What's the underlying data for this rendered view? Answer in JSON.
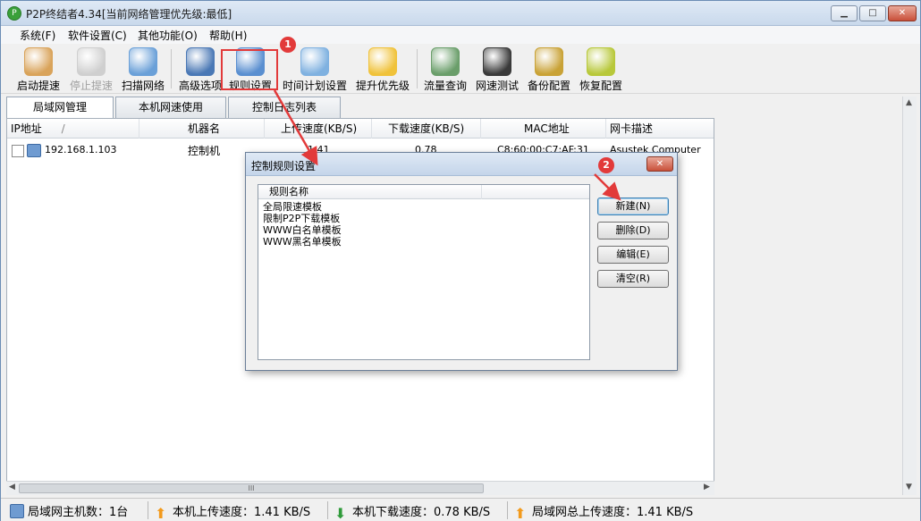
{
  "window": {
    "title": "P2P终结者4.34[当前网络管理优先级:最低]",
    "app_icon_glyph": "P",
    "min_glyph": "▁",
    "max_glyph": "□",
    "close_glyph": "✕"
  },
  "menu": [
    "系统(F)",
    "软件设置(C)",
    "其他功能(O)",
    "帮助(H)"
  ],
  "toolbar": [
    {
      "label": "启动提速",
      "icon": "rocket-icon",
      "color": "#d9a35a",
      "disabled": false
    },
    {
      "label": "停止提速",
      "icon": "stop-rocket-icon",
      "color": "#cfcfcf",
      "disabled": true
    },
    {
      "label": "扫描网络",
      "icon": "magnifier-icon",
      "color": "#6aa0d8",
      "disabled": false
    },
    {
      "label": "高级选项",
      "icon": "globe-gear-icon",
      "color": "#4a78b5",
      "disabled": false
    },
    {
      "label": "规则设置",
      "icon": "rules-icon",
      "color": "#5a8fd0",
      "disabled": false
    },
    {
      "label": "时间计划设置",
      "icon": "clock-icon",
      "color": "#7fb1e0",
      "disabled": false
    },
    {
      "label": "提升优先级",
      "icon": "medal-icon",
      "color": "#f0c23a",
      "disabled": false
    },
    {
      "label": "流量查询",
      "icon": "database-icon",
      "color": "#6a9e6a",
      "disabled": false
    },
    {
      "label": "网速测试",
      "icon": "speedometer-icon",
      "color": "#3a3a3a",
      "disabled": false
    },
    {
      "label": "备份配置",
      "icon": "backup-box-icon",
      "color": "#c9a236",
      "disabled": false
    },
    {
      "label": "恢复配置",
      "icon": "restore-box-icon",
      "color": "#b8c83a",
      "disabled": false
    }
  ],
  "annotations": {
    "badge1": "1",
    "badge2": "2"
  },
  "tabs": [
    "局域网管理",
    "本机网速使用",
    "控制日志列表"
  ],
  "list": {
    "columns": [
      "IP地址",
      "机器名",
      "上传速度(KB/S)",
      "下载速度(KB/S)",
      "MAC地址",
      "网卡描述"
    ],
    "sort_glyph": "/",
    "rows": [
      {
        "ip": "192.168.1.103",
        "name": "控制机",
        "upload": "1.41",
        "download": "0.78",
        "mac": "C8:60:00:C7:AF:31",
        "nic": "Asustek Computer"
      }
    ]
  },
  "scroll": {
    "thumb_glyph": "III",
    "left": "◀",
    "right": "▶",
    "up": "▲",
    "down": "▼"
  },
  "dialog": {
    "title": "控制规则设置",
    "close_glyph": "✕",
    "column": "规则名称",
    "rules": [
      "全局限速模板",
      "限制P2P下载模板",
      "WWW白名单模板",
      "WWW黑名单模板"
    ],
    "buttons": {
      "new": "新建(N)",
      "delete": "删除(D)",
      "edit": "编辑(E)",
      "clear": "清空(R)"
    }
  },
  "status": {
    "hosts": "局域网主机数：1台",
    "upload": "本机上传速度：1.41 KB/S",
    "download": "本机下载速度：0.78 KB/S",
    "lan_upload": "局域网总上传速度：1.41 KB/S"
  },
  "colors": {
    "highlight": "#e23a3a",
    "up_arrow": "#f29a1c",
    "down_arrow": "#2f9a3a"
  }
}
